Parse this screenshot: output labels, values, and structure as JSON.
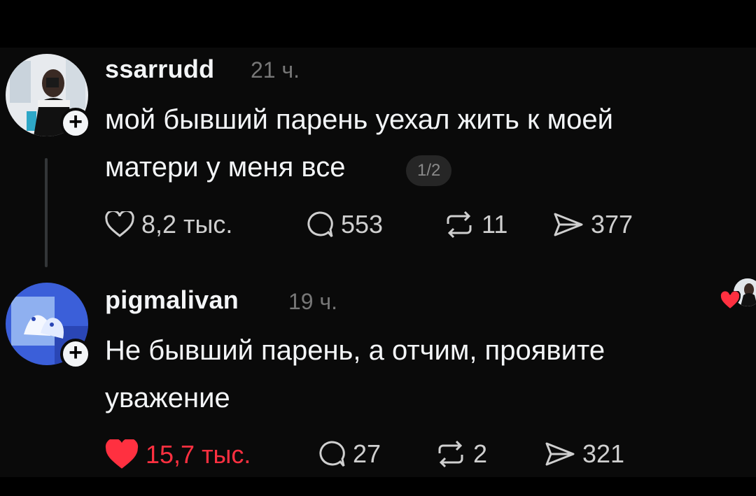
{
  "comments": [
    {
      "username": "ssarrudd",
      "time": "21 ч.",
      "lines": [
        "мой бывший парень уехал жить к моей",
        "матери у меня все"
      ],
      "pager": "1/2",
      "stats": {
        "likes": "8,2 тыс.",
        "replies": "553",
        "reposts": "11",
        "shares": "377"
      }
    },
    {
      "username": "pigmalivan",
      "time": "19 ч.",
      "lines": [
        "Не бывший парень, а отчим, проявите",
        "уважение"
      ],
      "stats": {
        "likes": "15,7 тыс.",
        "replies": "27",
        "reposts": "2",
        "shares": "321"
      }
    }
  ],
  "colors": {
    "background": "#0a0a0a",
    "text": "#f3f5f7",
    "muted": "#777777",
    "like": "#ff3040",
    "thread_line": "#333638"
  },
  "icons": [
    "follow-plus-icon",
    "heart-icon",
    "comment-icon",
    "repost-icon",
    "share-icon"
  ]
}
